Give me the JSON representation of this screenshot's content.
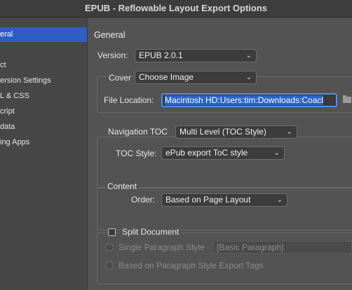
{
  "window": {
    "title": "EPUB - Reflowable Layout Export Options"
  },
  "sidebar": {
    "items": [
      {
        "label": "eral",
        "selected": true
      },
      {
        "label": "ct",
        "selected": false
      },
      {
        "label": "ersion Settings",
        "selected": false
      },
      {
        "label": "L & CSS",
        "selected": false
      },
      {
        "label": "cript",
        "selected": false
      },
      {
        "label": "data",
        "selected": false
      },
      {
        "label": "ing Apps",
        "selected": false
      }
    ]
  },
  "general": {
    "heading": "General",
    "version_label": "Version:",
    "version_value": "EPUB 2.0.1",
    "cover_label": "Cover",
    "cover_value": "Choose Image",
    "file_location_label": "File Location:",
    "file_location_value": "Macintosh HD:Users:tim:Downloads:Coacl",
    "nav_toc_label": "Navigation TOC",
    "nav_toc_value": "Multi Level (TOC Style)",
    "toc_style_label": "TOC Style:",
    "toc_style_value": "ePub export ToC style"
  },
  "content": {
    "heading": "Content",
    "order_label": "Order:",
    "order_value": "Based on Page Layout",
    "split_document_label": "Split Document",
    "split_document_checked": false,
    "single_paragraph_style_label": "Single Paragraph Style",
    "single_paragraph_style_value": "[Basic Paragraph]",
    "based_on_tags_label": "Based on Paragraph Style Export Tags"
  },
  "colors": {
    "accent": "#2f5dc4",
    "focus": "#4e8ef0",
    "panel": "#535353"
  }
}
